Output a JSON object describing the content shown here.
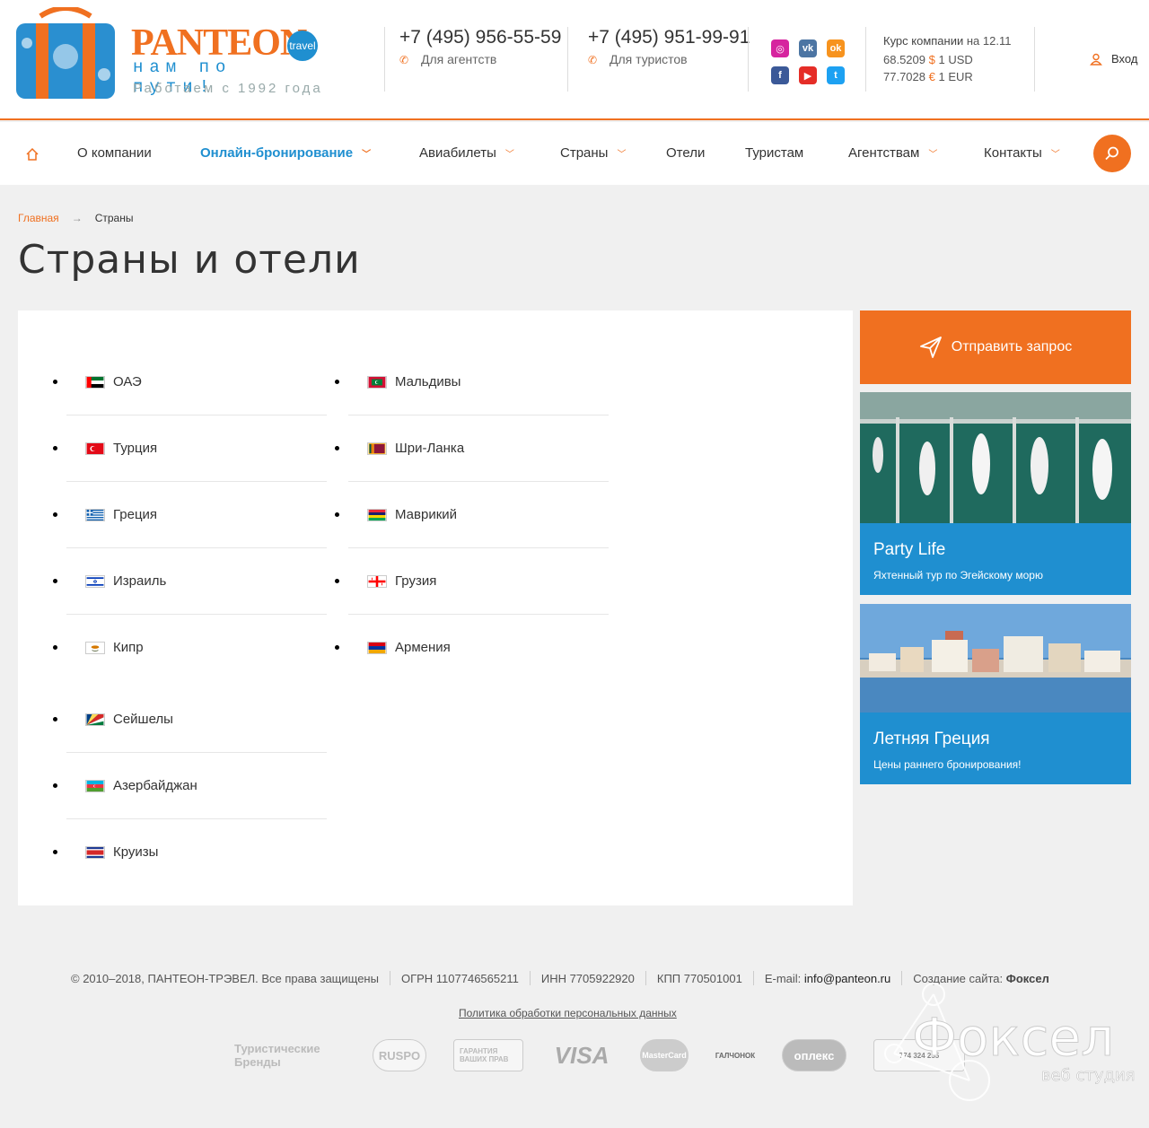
{
  "header": {
    "logo_name": "PANTEON",
    "logo_badge": "travel",
    "logo_slogan": "нам по пути!",
    "logo_since": "Работаем с 1992 года",
    "phones": [
      {
        "number": "+7 (495) 956-55-59",
        "label": "Для агентств"
      },
      {
        "number": "+7 (495) 951-99-91",
        "label": "Для туристов"
      }
    ],
    "social": [
      "instagram-icon",
      "vk-icon",
      "odnoklassniki-icon",
      "facebook-icon",
      "youtube-icon",
      "twitter-icon"
    ],
    "rates": {
      "title": "Курс компании",
      "date": "на 12.11",
      "usd_value": "68.5209",
      "usd_symbol": "$",
      "usd_label": "1 USD",
      "eur_value": "77.7028",
      "eur_symbol": "€",
      "eur_label": "1 EUR"
    },
    "login": "Вход"
  },
  "nav": {
    "items": [
      {
        "label": "О компании"
      },
      {
        "label": "Онлайн-бронирование"
      },
      {
        "label": "Авиабилеты"
      },
      {
        "label": "Страны"
      },
      {
        "label": "Отели"
      },
      {
        "label": "Туристам"
      },
      {
        "label": "Агентствам"
      },
      {
        "label": "Контакты"
      }
    ]
  },
  "breadcrumb": {
    "home": "Главная",
    "arrow": "→",
    "current": "Страны"
  },
  "page_title": "Страны и отели",
  "countries_left": [
    "ОАЭ",
    "Турция",
    "Греция",
    "Израиль",
    "Кипр",
    "Сейшелы",
    "Азербайджан",
    "Круизы"
  ],
  "countries_right": [
    "Мальдивы",
    "Шри-Ланка",
    "Маврикий",
    "Грузия",
    "Армения"
  ],
  "sidebar": {
    "send_request": "Отправить запрос",
    "promos": [
      {
        "title": "Party Life",
        "subtitle": "Яхтенный тур по Эгейскому морю"
      },
      {
        "title": "Летняя Греция",
        "subtitle": "Цены раннего бронирования!"
      }
    ]
  },
  "footer": {
    "copyright": "© 2010–2018, ПАНТЕОН-ТРЭВЕЛ. Все права защищены",
    "ogrn": "ОГРН 1107746565211",
    "inn": "ИНН 7705922920",
    "kpp": "КПП 770501001",
    "email_label": "E-mail:",
    "email": "info@panteon.ru",
    "created_by": "Создание сайта:",
    "studio": "Фоксел",
    "policy": "Политика обработки персональных данных",
    "partner_logos": [
      "Туристические Бренды",
      "RUSPO",
      "ГАРАНТИЯ ВАШИХ ПРАВ",
      "VISA",
      "MasterCard",
      "ГАЛЧОНОК",
      "оплекс",
      "774 324 255"
    ],
    "watermark_title": "Фоксел",
    "watermark_sub": "веб студия"
  },
  "colors": {
    "accent": "#f07020",
    "blue": "#1f8fd0",
    "bg": "#f0f0f0"
  }
}
